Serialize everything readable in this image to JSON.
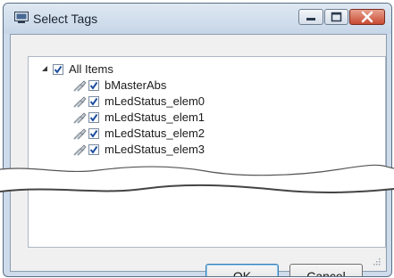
{
  "window": {
    "title": "Select Tags",
    "controls": {
      "minimize_icon": "minimize-icon",
      "maximize_icon": "maximize-icon",
      "close_icon": "close-icon"
    }
  },
  "tree": {
    "root": {
      "label": "All Items",
      "expanded": true,
      "checked": true
    },
    "items": [
      {
        "label": "bMasterAbs",
        "checked": true,
        "icon": "tag-icon"
      },
      {
        "label": "mLedStatus_elem0",
        "checked": true,
        "icon": "tag-icon"
      },
      {
        "label": "mLedStatus_elem1",
        "checked": true,
        "icon": "tag-icon"
      },
      {
        "label": "mLedStatus_elem2",
        "checked": true,
        "icon": "tag-icon"
      },
      {
        "label": "mLedStatus_elem3",
        "checked": true,
        "icon": "tag-icon"
      }
    ]
  },
  "buttons": {
    "ok": "OK",
    "cancel": "Cancel"
  },
  "colors": {
    "title_bar": "#c6d6e8",
    "close_button": "#c94a33",
    "check_mark": "#1f4fa0"
  }
}
